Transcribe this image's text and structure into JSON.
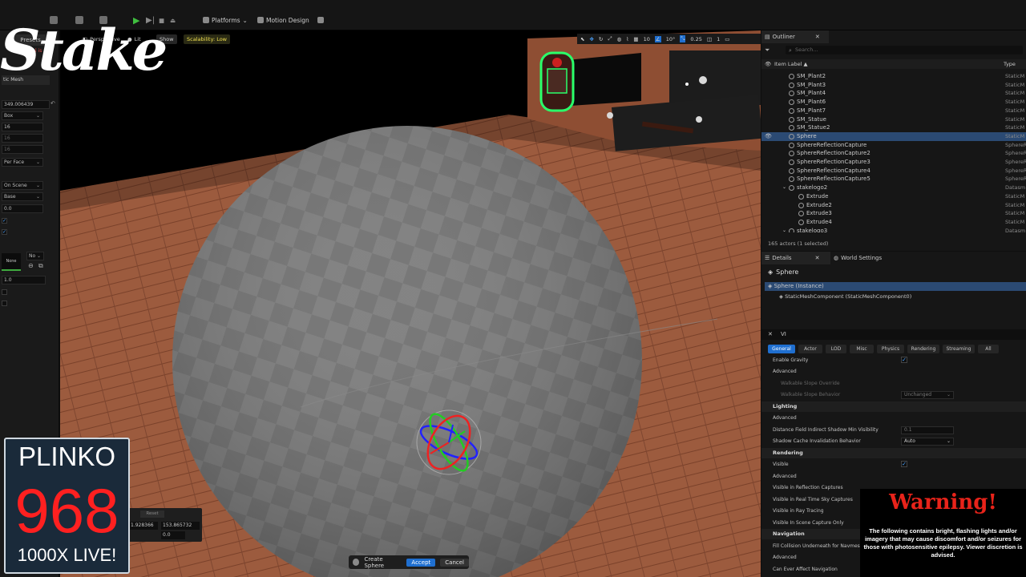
{
  "toolbar": {
    "platforms_label": "Platforms",
    "motion_design_label": "Motion Design"
  },
  "left_panel": {
    "presets_label": "Presets",
    "tool_hint": "Tool is",
    "mesh_label": "tic Mesh",
    "value_main": "349.006439",
    "shape_select": "Box",
    "num1": "16",
    "num2": "16",
    "num3": "16",
    "uv_select": "Per Face",
    "placement_select": "On Scene",
    "pivot_select": "Base",
    "offset_value": "0.0",
    "material_none": "None",
    "no_select": "No",
    "scale_value": "1.0"
  },
  "viewport": {
    "perspective_label": "Perspective",
    "lit_label": "Lit",
    "show_label": "Show",
    "scalability_label": "Scalability: Low",
    "grid_snap": "10",
    "rot_snap": "10°",
    "scale_snap": "0.25",
    "cam_speed": "1",
    "reset_label": "Reset",
    "field_a": "1.928366",
    "field_b": "153.865732",
    "field_c": "0.0",
    "create_label": "Create Sphere",
    "accept_label": "Accept",
    "cancel_label": "Cancel"
  },
  "overlay": {
    "brand": "Stake",
    "plinko_title": "PLINKO",
    "plinko_number": "968",
    "plinko_sub": "1000X LIVE!",
    "warning_title": "Warning!",
    "warning_text": "The following contains bright, flashing lights and/or imagery that may cause discomfort and/or seizures for those with photosensitive epilepsy. Viewer discretion is advised."
  },
  "outliner": {
    "tab_label": "Outliner",
    "search_placeholder": "Search...",
    "col_label": "Item Label ▲",
    "col_type": "Type",
    "rows": [
      {
        "label": "SM_Plant2",
        "type": "StaticM",
        "indent": 1,
        "selected": false
      },
      {
        "label": "SM_Plant3",
        "type": "StaticM",
        "indent": 1,
        "selected": false
      },
      {
        "label": "SM_Plant4",
        "type": "StaticM",
        "indent": 1,
        "selected": false
      },
      {
        "label": "SM_Plant6",
        "type": "StaticM",
        "indent": 1,
        "selected": false
      },
      {
        "label": "SM_Plant7",
        "type": "StaticM",
        "indent": 1,
        "selected": false
      },
      {
        "label": "SM_Statue",
        "type": "StaticM",
        "indent": 1,
        "selected": false
      },
      {
        "label": "SM_Statue2",
        "type": "StaticM",
        "indent": 1,
        "selected": false
      },
      {
        "label": "Sphere",
        "type": "StaticM",
        "indent": 1,
        "selected": true
      },
      {
        "label": "SphereReflectionCapture",
        "type": "SphereR",
        "indent": 1,
        "selected": false
      },
      {
        "label": "SphereReflectionCapture2",
        "type": "SphereR",
        "indent": 1,
        "selected": false
      },
      {
        "label": "SphereReflectionCapture3",
        "type": "SphereR",
        "indent": 1,
        "selected": false
      },
      {
        "label": "SphereReflectionCapture4",
        "type": "SphereR",
        "indent": 1,
        "selected": false
      },
      {
        "label": "SphereReflectionCapture5",
        "type": "SphereR",
        "indent": 1,
        "selected": false
      },
      {
        "label": "stakelogo2",
        "type": "Datasm",
        "indent": 0,
        "selected": false
      },
      {
        "label": "Extrude",
        "type": "StaticM",
        "indent": 2,
        "selected": false
      },
      {
        "label": "Extrude2",
        "type": "StaticM",
        "indent": 2,
        "selected": false
      },
      {
        "label": "Extrude3",
        "type": "StaticM",
        "indent": 2,
        "selected": false
      },
      {
        "label": "Extrude4",
        "type": "StaticM",
        "indent": 2,
        "selected": false
      },
      {
        "label": "stakelogo3",
        "type": "Datasm",
        "indent": 0,
        "selected": false
      }
    ],
    "footer": "165 actors (1 selected)"
  },
  "details": {
    "tab_label": "Details",
    "world_settings_label": "World Settings",
    "object_name": "Sphere",
    "instance_label": "Sphere (Instance)",
    "component_label": "StaticMeshComponent (StaticMeshComponent0)",
    "search_text": "VI",
    "tabs": [
      "General",
      "Actor",
      "LOD",
      "Misc",
      "Physics",
      "Rendering",
      "Streaming",
      "All"
    ],
    "props": {
      "enable_gravity": "Enable Gravity",
      "advanced": "Advanced",
      "walkable_override": "Walkable Slope Override",
      "walkable_behavior": "Walkable Slope Behavior",
      "unchanged": "Unchanged",
      "lighting": "Lighting",
      "dist_field": "Distance Field Indirect Shadow Min Visibility",
      "dist_value": "0.1",
      "shadow_cache": "Shadow Cache Invalidation Behavior",
      "auto": "Auto",
      "rendering": "Rendering",
      "visible": "Visible",
      "vis_reflection": "Visible in Reflection Captures",
      "vis_sky": "Visible in Real Time Sky Captures",
      "vis_ray": "Visible in Ray Tracing",
      "vis_scene_only": "Visible In Scene Capture Only",
      "navigation": "Navigation",
      "fill_collision": "Fill Collision Underneath for Navmesh",
      "can_affect_nav": "Can Ever Affect Navigation"
    }
  },
  "colors": {
    "accent": "#1f6fd0",
    "selection": "#2b4a73",
    "floor": "#9a5a3c",
    "plinko_red": "#ff2020",
    "warning_red": "#e8231a"
  }
}
